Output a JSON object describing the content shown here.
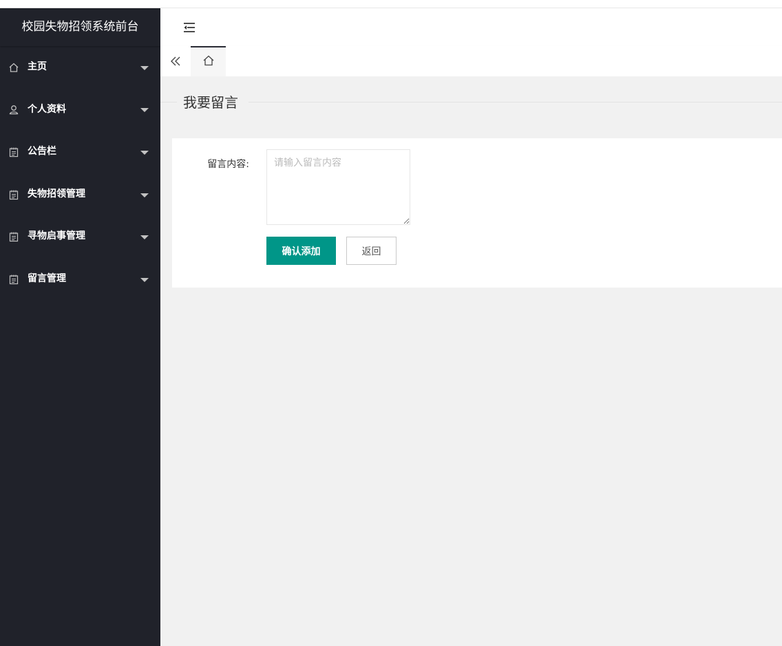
{
  "app": {
    "title": "校园失物招领系统前台"
  },
  "sidebar": {
    "items": [
      {
        "label": "主页",
        "icon": "home-icon"
      },
      {
        "label": "个人资料",
        "icon": "user-icon"
      },
      {
        "label": "公告栏",
        "icon": "notepad-icon"
      },
      {
        "label": "失物招领管理",
        "icon": "notepad-icon"
      },
      {
        "label": "寻物启事管理",
        "icon": "notepad-icon"
      },
      {
        "label": "留言管理",
        "icon": "notepad-icon"
      }
    ]
  },
  "header": {
    "toggle_icon": "menu-fold-icon"
  },
  "tabs": {
    "prev_icon": "double-left-icon",
    "home_icon": "home-icon"
  },
  "page": {
    "legend": "我要留言",
    "form": {
      "content_label": "留言内容:",
      "content_value": "",
      "content_placeholder": "请输入留言内容",
      "submit_label": "确认添加",
      "back_label": "返回"
    }
  },
  "colors": {
    "sidebar_bg": "#20222a",
    "primary": "#009688",
    "content_bg": "#f1f1f1"
  }
}
